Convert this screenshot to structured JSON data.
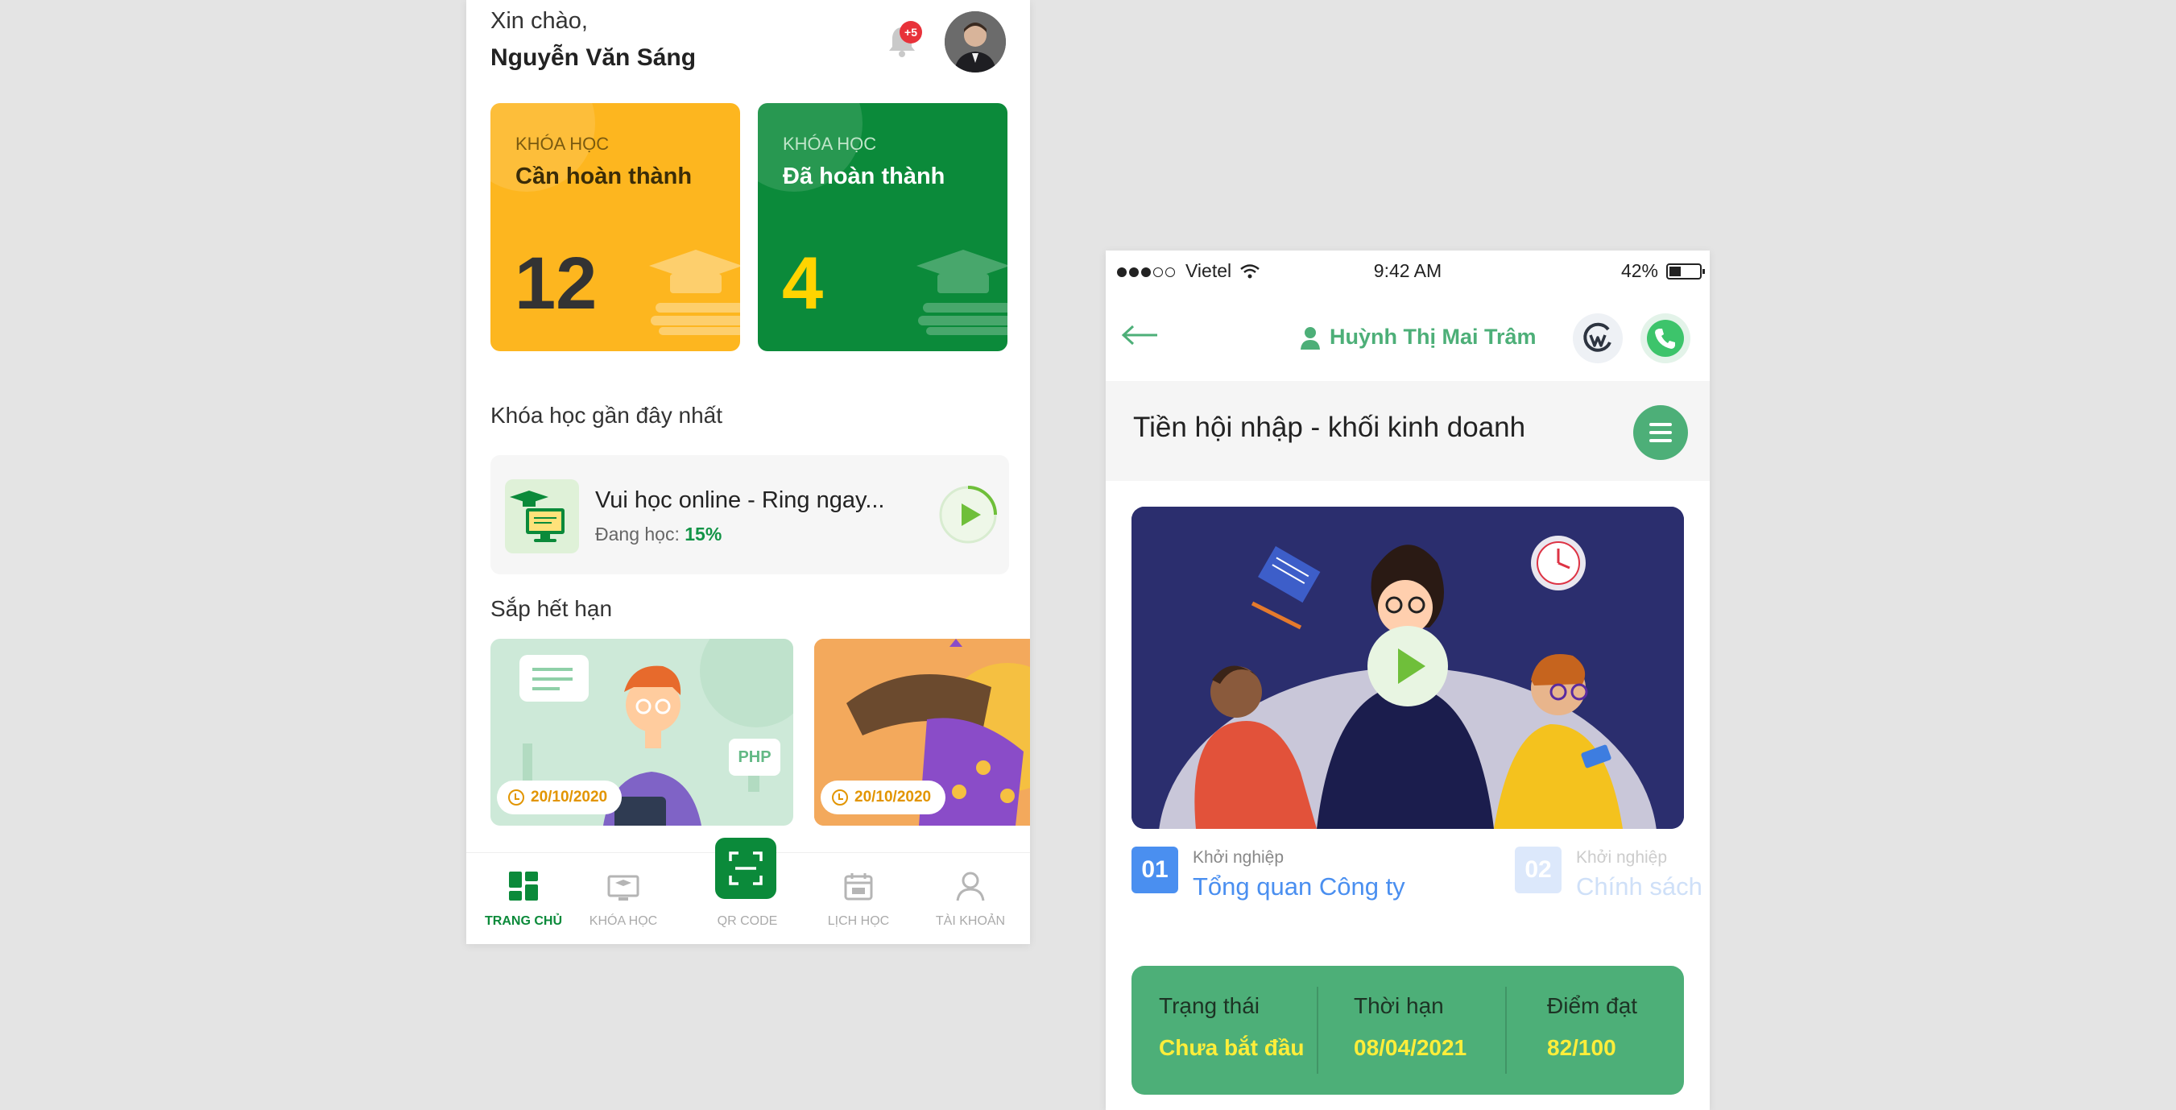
{
  "home": {
    "greeting": "Xin chào,",
    "user_name": "Nguyễn Văn Sáng",
    "notification_count": "+5",
    "stats": [
      {
        "caption": "KHÓA HỌC",
        "label": "Cần hoàn thành",
        "count": "12"
      },
      {
        "caption": "KHÓA HỌC",
        "label": "Đã hoàn thành",
        "count": "4"
      }
    ],
    "recent_heading": "Khóa học gần đây nhất",
    "recent_course": {
      "title": "Vui học online - Ring ngay...",
      "progress_label": "Đang học:",
      "progress_value": "15%",
      "progress_fraction": 0.15
    },
    "expiring_heading": "Sắp hết hạn",
    "expiring": [
      {
        "badge_text": "PHP",
        "date": "20/10/2020"
      },
      {
        "date": "20/10/2020"
      }
    ],
    "tabs": [
      {
        "label": "TRANG CHỦ",
        "icon": "dashboard-icon",
        "active": true
      },
      {
        "label": "KHÓA HỌC",
        "icon": "course-icon",
        "active": false
      },
      {
        "label": "QR CODE",
        "icon": "qr-scan-icon",
        "active": false
      },
      {
        "label": "LỊCH HỌC",
        "icon": "calendar-icon",
        "active": false
      },
      {
        "label": "TÀI KHOẢN",
        "icon": "user-icon",
        "active": false
      }
    ],
    "colors": {
      "primary_green": "#0b8a3a",
      "yellow": "#fdb61f",
      "accent_yellow": "#ffd400"
    }
  },
  "detail": {
    "status_bar": {
      "carrier": "Vietel",
      "time": "9:42 AM",
      "battery": "42%"
    },
    "instructor": "Huỳnh Thị Mai Trâm",
    "course_title": "Tiền hội nhập - khối kinh doanh",
    "lessons": [
      {
        "number": "01",
        "category": "Khởi nghiệp",
        "title": "Tổng quan Công ty"
      },
      {
        "number": "02",
        "category": "Khởi nghiệp",
        "title": "Chính sách"
      }
    ],
    "status": [
      {
        "label": "Trạng thái",
        "value": "Chưa bắt đầu"
      },
      {
        "label": "Thời hạn",
        "value": "08/04/2021"
      },
      {
        "label": "Điểm đạt",
        "value": "82/100"
      }
    ],
    "colors": {
      "green": "#4daf78",
      "blue": "#4a8ff0",
      "value_yellow": "#ffee3a"
    }
  }
}
